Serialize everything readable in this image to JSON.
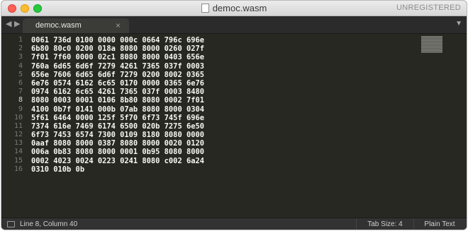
{
  "window": {
    "title": "democ.wasm",
    "registration": "UNREGISTERED"
  },
  "tabs": [
    {
      "label": "democ.wasm",
      "close": "×"
    }
  ],
  "nav": {
    "back": "◀",
    "forward": "▶",
    "menu": "▼"
  },
  "editor": {
    "current_line": 8,
    "line_numbers": [
      "1",
      "2",
      "3",
      "4",
      "5",
      "6",
      "7",
      "8",
      "9",
      "10",
      "11",
      "12",
      "13",
      "14",
      "15",
      "16"
    ],
    "lines": [
      "0061 736d 0100 0000 000c 0664 796c 696e",
      "6b80 80c0 0200 018a 8080 8000 0260 027f",
      "7f01 7f60 0000 02c1 8080 8000 0403 656e",
      "760a 6d65 6d6f 7279 4261 7365 037f 0003",
      "656e 7606 6d65 6d6f 7279 0200 8002 0365",
      "6e76 0574 6162 6c65 0170 0000 0365 6e76",
      "0974 6162 6c65 4261 7365 037f 0003 8480",
      "8080 0003 0001 0106 8b80 8080 0002 7f01",
      "4100 0b7f 0141 000b 07ab 8080 8000 0304",
      "5f61 6464 0000 125f 5f70 6f73 745f 696e",
      "7374 616e 7469 6174 6500 020b 7275 6e50",
      "6f73 7453 6574 7300 0109 8180 8080 0000",
      "0aaf 8080 8000 0387 8080 8000 0020 0120",
      "006a 0b83 8080 8000 0001 0b95 8080 8000",
      "0002 4023 0024 0223 0241 8080 c002 6a24",
      "0310 010b 0b"
    ]
  },
  "status": {
    "position": "Line 8, Column 40",
    "tab_size": "Tab Size: 4",
    "syntax": "Plain Text"
  },
  "colors": {
    "editor_bg": "#272822",
    "text": "#f8f8f2",
    "gutter_text": "#7b7b6e"
  }
}
